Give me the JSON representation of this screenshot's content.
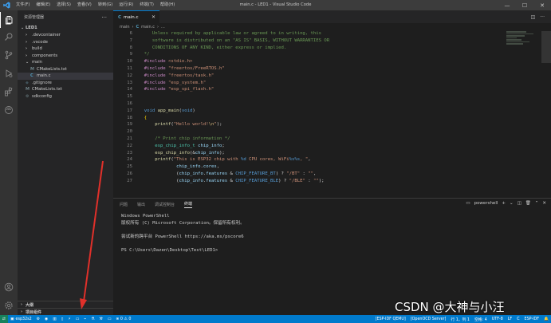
{
  "titlebar": {
    "menu": [
      "文件(F)",
      "编辑(E)",
      "选择(S)",
      "查看(V)",
      "转到(G)",
      "运行(R)",
      "终端(T)",
      "帮助(H)"
    ],
    "window_title": "main.c - LED1 - Visual Studio Code"
  },
  "sidebar": {
    "title": "资源管理器",
    "more": "···",
    "folder": "LED1",
    "items": [
      {
        "label": ".devcontainer",
        "kind": "folder",
        "depth": 1
      },
      {
        "label": ".vscode",
        "kind": "folder",
        "depth": 1
      },
      {
        "label": "build",
        "kind": "folder",
        "depth": 1
      },
      {
        "label": "components",
        "kind": "folder",
        "depth": 1
      },
      {
        "label": "main",
        "kind": "folder-open",
        "depth": 1
      },
      {
        "label": "CMakeLists.txt",
        "kind": "cmake",
        "depth": 2
      },
      {
        "label": "main.c",
        "kind": "c",
        "depth": 2,
        "selected": true
      },
      {
        "label": ".gitignore",
        "kind": "git",
        "depth": 1
      },
      {
        "label": "CMakeLists.txt",
        "kind": "cmake",
        "depth": 1
      },
      {
        "label": "sdkconfig",
        "kind": "config",
        "depth": 1
      }
    ],
    "sections": [
      "大纲",
      "项目组件"
    ]
  },
  "editor": {
    "tab_label": "main.c",
    "tab_icon": "C",
    "breadcrumb": [
      "main",
      "main.c",
      "..."
    ],
    "code": [
      {
        "n": "6",
        "parts": [
          [
            "c-comment",
            "     Unless required by applicable law or agreed to in writing, this"
          ]
        ]
      },
      {
        "n": "7",
        "parts": [
          [
            "c-comment",
            "     software is distributed on an \"AS IS\" BASIS, WITHOUT WARRANTIES OR"
          ]
        ]
      },
      {
        "n": "8",
        "parts": [
          [
            "c-comment",
            "     CONDITIONS OF ANY KIND, either express or implied."
          ]
        ]
      },
      {
        "n": "9",
        "parts": [
          [
            "c-comment",
            "  */"
          ]
        ]
      },
      {
        "n": "10",
        "parts": [
          [
            "c-pp",
            "  #include "
          ],
          [
            "c-str",
            "<stdio.h>"
          ]
        ]
      },
      {
        "n": "11",
        "parts": [
          [
            "c-pp",
            "  #include "
          ],
          [
            "c-str",
            "\"freertos/FreeRTOS.h\""
          ]
        ]
      },
      {
        "n": "12",
        "parts": [
          [
            "c-pp",
            "  #include "
          ],
          [
            "c-str",
            "\"freertos/task.h\""
          ]
        ]
      },
      {
        "n": "13",
        "parts": [
          [
            "c-pp",
            "  #include "
          ],
          [
            "c-str",
            "\"esp_system.h\""
          ]
        ]
      },
      {
        "n": "14",
        "parts": [
          [
            "c-pp",
            "  #include "
          ],
          [
            "c-str",
            "\"esp_spi_flash.h\""
          ]
        ]
      },
      {
        "n": "15",
        "parts": [
          [
            "c-punc",
            ""
          ]
        ]
      },
      {
        "n": "16",
        "parts": [
          [
            "c-punc",
            ""
          ]
        ]
      },
      {
        "n": "17",
        "parts": [
          [
            "c-kw",
            "  void "
          ],
          [
            "c-fn",
            "app_main"
          ],
          [
            "c-punc",
            "("
          ],
          [
            "c-kw",
            "void"
          ],
          [
            "c-punc",
            ")"
          ]
        ]
      },
      {
        "n": "18",
        "parts": [
          [
            "c-brace",
            "  {"
          ]
        ]
      },
      {
        "n": "19",
        "parts": [
          [
            "c-fn",
            "      printf"
          ],
          [
            "c-punc",
            "("
          ],
          [
            "c-str",
            "\"Hello world!"
          ],
          [
            "c-esc",
            "\\n"
          ],
          [
            "c-str",
            "\""
          ],
          [
            "c-punc",
            ");"
          ]
        ]
      },
      {
        "n": "20",
        "parts": [
          [
            "c-punc",
            ""
          ]
        ]
      },
      {
        "n": "21",
        "parts": [
          [
            "c-comment",
            "      /* Print chip information */"
          ]
        ]
      },
      {
        "n": "22",
        "parts": [
          [
            "c-type",
            "      esp_chip_info_t "
          ],
          [
            "c-var",
            "chip_info"
          ],
          [
            "c-punc",
            ";"
          ]
        ]
      },
      {
        "n": "23",
        "parts": [
          [
            "c-fn",
            "      esp_chip_info"
          ],
          [
            "c-punc",
            "(&"
          ],
          [
            "c-var",
            "chip_info"
          ],
          [
            "c-punc",
            ");"
          ]
        ]
      },
      {
        "n": "24",
        "parts": [
          [
            "c-fn",
            "      printf"
          ],
          [
            "c-punc",
            "("
          ],
          [
            "c-str",
            "\"This is ESP32 chip with "
          ],
          [
            "c-kw",
            "%d"
          ],
          [
            "c-str",
            " CPU cores, WiFi"
          ],
          [
            "c-kw",
            "%s%s"
          ],
          [
            "c-str",
            ", \""
          ],
          [
            "c-punc",
            ","
          ]
        ]
      },
      {
        "n": "25",
        "parts": [
          [
            "c-var",
            "              chip_info"
          ],
          [
            "c-punc",
            "."
          ],
          [
            "c-var",
            "cores"
          ],
          [
            "c-punc",
            ","
          ]
        ]
      },
      {
        "n": "26",
        "parts": [
          [
            "c-punc",
            "              ("
          ],
          [
            "c-var",
            "chip_info"
          ],
          [
            "c-punc",
            "."
          ],
          [
            "c-var",
            "features"
          ],
          [
            "c-punc",
            " & "
          ],
          [
            "c-macro",
            "CHIP_FEATURE_BT"
          ],
          [
            "c-punc",
            ") ? "
          ],
          [
            "c-str",
            "\"/BT\""
          ],
          [
            "c-punc",
            " : "
          ],
          [
            "c-str",
            "\"\""
          ],
          [
            "c-punc",
            ","
          ]
        ]
      },
      {
        "n": "27",
        "parts": [
          [
            "c-punc",
            "              ("
          ],
          [
            "c-var",
            "chip_info"
          ],
          [
            "c-punc",
            "."
          ],
          [
            "c-var",
            "features"
          ],
          [
            "c-punc",
            " & "
          ],
          [
            "c-macro",
            "CHIP_FEATURE_BLE"
          ],
          [
            "c-punc",
            ") ? "
          ],
          [
            "c-str",
            "\"/BLE\""
          ],
          [
            "c-punc",
            " : "
          ],
          [
            "c-str",
            "\"\""
          ],
          [
            "c-punc",
            ");"
          ]
        ]
      }
    ]
  },
  "panel": {
    "tabs": [
      "问题",
      "输出",
      "调试控制台",
      "终端"
    ],
    "active_tab": "终端",
    "terminal_name": "powershell",
    "terminal_lines": [
      "Windows PowerShell",
      "版权所有 (C) Microsoft Corporation。保留所有权利。",
      "",
      "尝试新的跨平台 PowerShell https://aka.ms/pscore6",
      "",
      "PS C:\\Users\\Dazen\\Desktop\\Test\\LED1>"
    ]
  },
  "statusbar": {
    "target": "esp32s2",
    "problems": "⊗ 0  ⚠ 0",
    "right": [
      "[ESP-IDF QEMU]",
      "[OpenOCD Server]",
      "行 1，列 1",
      "空格: 4",
      "UTF-8",
      "LF",
      "C",
      "ESP-IDF"
    ]
  },
  "watermark": "CSDN @大神与小汪",
  "colors": {
    "accent": "#007acc",
    "annotation_arrow": "#e0302a"
  }
}
